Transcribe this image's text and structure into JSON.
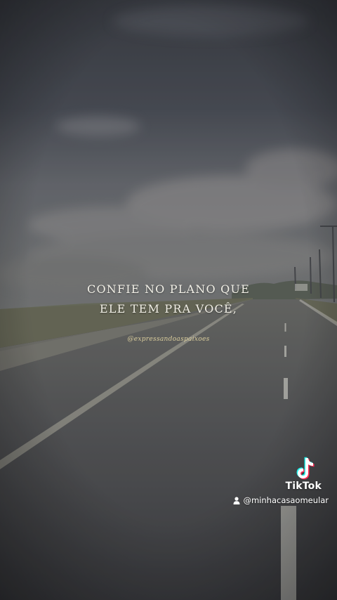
{
  "quote": {
    "line1": "CONFIE NO PLANO QUE",
    "line2": "ELE TEM PRA VOCÊ,"
  },
  "watermark": "@expressandoaspaixoes",
  "tiktok": {
    "brand": "TikTok",
    "username": "@minhacasaomeular",
    "logo_icon": "tiktok-note-icon",
    "user_icon": "person-icon"
  },
  "colors": {
    "quote_text": "#f1efe6",
    "watermark_text": "#e7d9a3",
    "tiktok_cyan": "#25f4ee",
    "tiktok_red": "#fe2c55"
  }
}
